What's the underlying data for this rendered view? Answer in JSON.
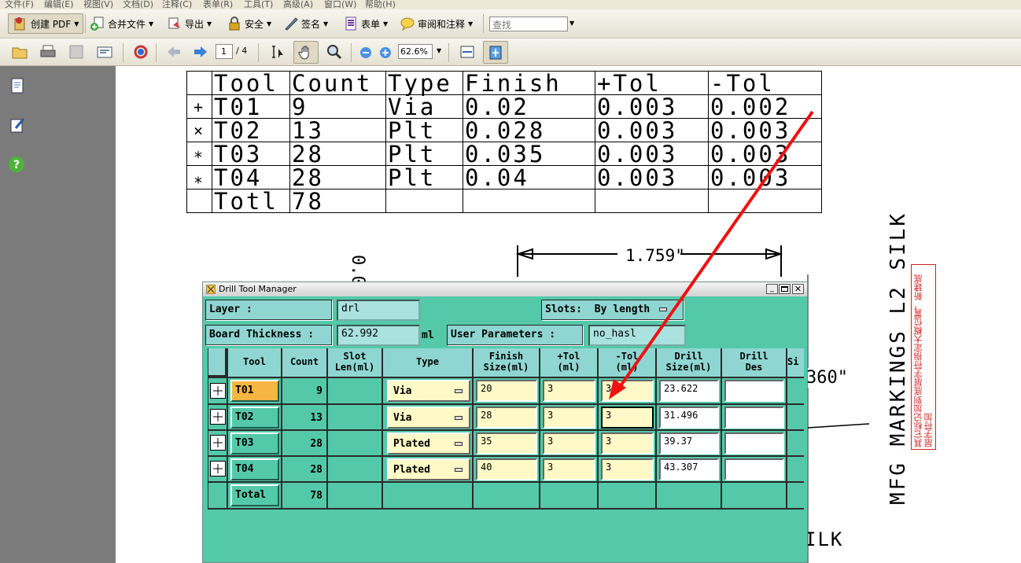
{
  "menu": [
    "文件(F)",
    "编辑(E)",
    "视图(V)",
    "文档(D)",
    "注释(C)",
    "表单(R)",
    "工具(T)",
    "高级(A)",
    "窗口(W)",
    "帮助(H)"
  ],
  "toolbar1": {
    "create_pdf": "创建 PDF",
    "combine": "合并文件",
    "export": "导出",
    "secure": "安全",
    "sign": "签名",
    "forms": "表单",
    "review": "审阅和注释",
    "search_placeholder": "查找"
  },
  "toolbar2": {
    "page_current": "1",
    "page_total": "/ 4",
    "zoom": "62.6%"
  },
  "document": {
    "table": {
      "headers": [
        "Tool",
        "Count",
        "Type",
        "Finish",
        "+Tol",
        "-Tol"
      ],
      "rows": [
        {
          "sym": "+",
          "cells": [
            "T01",
            "9",
            "Via",
            "0.02",
            "0.003",
            "0.002"
          ]
        },
        {
          "sym": "×",
          "cells": [
            "T02",
            "13",
            "Plt",
            "0.028",
            "0.003",
            "0.003"
          ]
        },
        {
          "sym": "∗",
          "cells": [
            "T03",
            "28",
            "Plt",
            "0.035",
            "0.003",
            "0.003"
          ]
        },
        {
          "sym": "⁎",
          "cells": [
            "T04",
            "28",
            "Plt",
            "0.04",
            "0.003",
            "0.003"
          ]
        },
        {
          "sym": "",
          "cells": [
            "Totl",
            "78",
            "",
            "",
            "",
            ""
          ]
        }
      ]
    },
    "dim_label": "1.759\"",
    "vert_dim": "0.0\"",
    "dim_right": "360\"",
    "silk_text": "MFG MARKINGS L2 SILK",
    "silk_bottom": "ILK",
    "annotation": "其它标记加到底层字符指定大概位置，新建底层字符加"
  },
  "dialog": {
    "title": "Drill Tool Manager",
    "layer_label": "Layer         :",
    "layer_value": "drl",
    "slots_label": "Slots:",
    "slots_value": "By length",
    "thickness_label": "Board Thickness :",
    "thickness_value": "62.992",
    "thickness_unit": "ml",
    "userparams_label": "User Parameters :",
    "userparams_value": "no_hasl",
    "columns": [
      {
        "key": "tool",
        "label1": "Tool",
        "label2": ""
      },
      {
        "key": "count",
        "label1": "Count",
        "label2": ""
      },
      {
        "key": "slot",
        "label1": "Slot",
        "label2": "Len(ml)"
      },
      {
        "key": "type",
        "label1": "Type",
        "label2": ""
      },
      {
        "key": "finish",
        "label1": "Finish",
        "label2": "Size(ml)"
      },
      {
        "key": "ptol",
        "label1": "+Tol",
        "label2": "(ml)"
      },
      {
        "key": "mtol",
        "label1": "-Tol",
        "label2": "(ml)"
      },
      {
        "key": "drill",
        "label1": "Drill",
        "label2": "Size(ml)"
      },
      {
        "key": "des",
        "label1": "Drill",
        "label2": "Des"
      },
      {
        "key": "si",
        "label1": "Si",
        "label2": ""
      }
    ],
    "rows": [
      {
        "tool": "T01",
        "count": "9",
        "type": "Via",
        "finish": "20",
        "ptol": "3",
        "mtol": "3",
        "drill": "23.622",
        "selected": true
      },
      {
        "tool": "T02",
        "count": "13",
        "type": "Via",
        "finish": "28",
        "ptol": "3",
        "mtol": "3",
        "drill": "31.496"
      },
      {
        "tool": "T03",
        "count": "28",
        "type": "Plated",
        "finish": "35",
        "ptol": "3",
        "mtol": "3",
        "drill": "39.37"
      },
      {
        "tool": "T04",
        "count": "28",
        "type": "Plated",
        "finish": "40",
        "ptol": "3",
        "mtol": "3",
        "drill": "43.307"
      }
    ],
    "total_label": "Total",
    "total_count": "78"
  },
  "colors": {
    "dialog_bg": "#54c9a9",
    "field_bg": "#fef9c6",
    "selected_tool": "#f7b541",
    "arrow": "#ee1111"
  }
}
